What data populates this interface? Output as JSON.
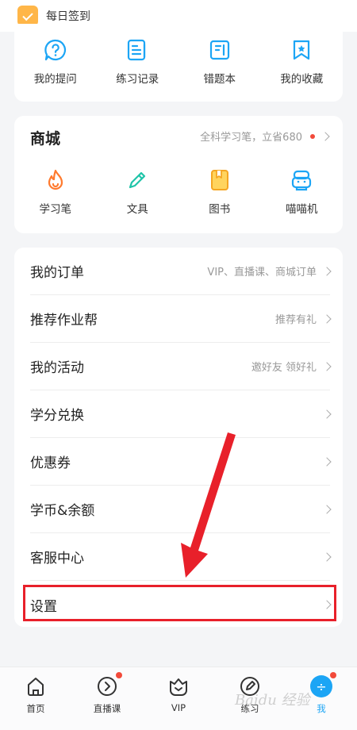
{
  "checkin": {
    "label": "每日签到"
  },
  "study": {
    "items": [
      {
        "label": "我的提问",
        "icon": "question-icon"
      },
      {
        "label": "练习记录",
        "icon": "record-icon"
      },
      {
        "label": "错题本",
        "icon": "notebook-icon"
      },
      {
        "label": "我的收藏",
        "icon": "bookmark-icon"
      }
    ]
  },
  "mall": {
    "title": "商城",
    "promo": "全科学习笔，立省680",
    "items": [
      {
        "label": "学习笔",
        "icon": "pen-flame-icon"
      },
      {
        "label": "文具",
        "icon": "pencil-icon"
      },
      {
        "label": "图书",
        "icon": "book-icon"
      },
      {
        "label": "喵喵机",
        "icon": "printer-icon"
      }
    ]
  },
  "menu": {
    "rows": [
      {
        "label": "我的订单",
        "hint": "VIP、直播课、商城订单"
      },
      {
        "label": "推荐作业帮",
        "hint": "推荐有礼"
      },
      {
        "label": "我的活动",
        "hint": "邀好友 领好礼"
      },
      {
        "label": "学分兑换",
        "hint": ""
      },
      {
        "label": "优惠券",
        "hint": ""
      },
      {
        "label": "学币&余额",
        "hint": ""
      },
      {
        "label": "客服中心",
        "hint": ""
      },
      {
        "label": "设置",
        "hint": ""
      }
    ]
  },
  "tabbar": {
    "tabs": [
      {
        "label": "首页",
        "icon": "home-icon"
      },
      {
        "label": "直播课",
        "icon": "live-play-icon"
      },
      {
        "label": "VIP",
        "icon": "vip-crown-icon"
      },
      {
        "label": "练习",
        "icon": "practice-icon"
      },
      {
        "label": "我",
        "icon": "profile-icon"
      }
    ]
  },
  "watermark": "Baidu 经验",
  "colors": {
    "accent": "#1ca5f5",
    "highlight": "#e8202a",
    "badge": "#f24a3a",
    "checkin": "#ffb648"
  }
}
